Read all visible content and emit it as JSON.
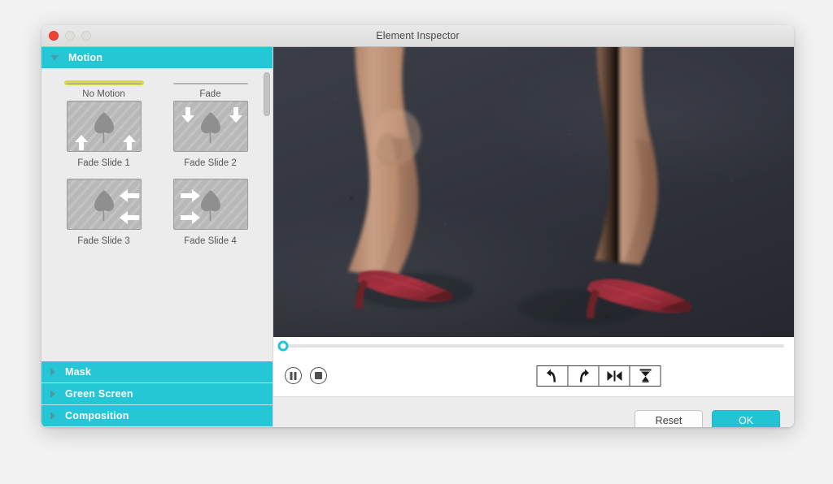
{
  "window": {
    "title": "Element Inspector",
    "traffic_lights": [
      {
        "name": "close",
        "color": "#f04134",
        "active": true
      },
      {
        "name": "minimize",
        "color": "#dededc",
        "active": false
      },
      {
        "name": "maximize",
        "color": "#dededc",
        "active": false
      }
    ]
  },
  "colors": {
    "accent_teal": "#22c4d4",
    "header_teal": "#25c6d6",
    "selection_yellow": "#d8d93a",
    "window_bg": "#ececec",
    "preview_bg": "#31343c"
  },
  "sidebar": {
    "sections": [
      {
        "id": "motion",
        "label": "Motion",
        "expanded": true,
        "triangle": "triangle-down-icon"
      },
      {
        "id": "mask",
        "label": "Mask",
        "expanded": false,
        "triangle": "triangle-right-icon"
      },
      {
        "id": "greenscreen",
        "label": "Green Screen",
        "expanded": false,
        "triangle": "triangle-right-icon"
      },
      {
        "id": "composition",
        "label": "Composition",
        "expanded": false,
        "triangle": "triangle-right-icon"
      }
    ],
    "motion_presets": [
      {
        "id": "no-motion",
        "label": "No Motion",
        "selected": true,
        "tone": "light",
        "arrows": "none"
      },
      {
        "id": "fade",
        "label": "Fade",
        "selected": false,
        "tone": "light",
        "arrows": "none"
      },
      {
        "id": "fade-slide-1",
        "label": "Fade Slide 1",
        "selected": false,
        "tone": "dark",
        "arrows": "up-bottom-corners"
      },
      {
        "id": "fade-slide-2",
        "label": "Fade Slide 2",
        "selected": false,
        "tone": "dark",
        "arrows": "down-top-corners"
      },
      {
        "id": "fade-slide-3",
        "label": "Fade Slide 3",
        "selected": false,
        "tone": "dark",
        "arrows": "left-right-edge"
      },
      {
        "id": "fade-slide-4",
        "label": "Fade Slide 4",
        "selected": false,
        "tone": "dark",
        "arrows": "right-left-edge"
      }
    ],
    "scrollbar": {
      "visible": true,
      "thumb_position_percent": 2
    }
  },
  "preview": {
    "description": "Video frame: woman's legs walking on dark asphalt wearing red pointed high heels"
  },
  "scrubber": {
    "position_percent": 0,
    "playhead_icon": "playhead-circle-icon"
  },
  "transport": {
    "pause_icon": "pause-circle-icon",
    "stop_icon": "stop-circle-icon",
    "tools": [
      {
        "id": "tool-1",
        "icon": "arrow-curve-up-left-icon"
      },
      {
        "id": "tool-2",
        "icon": "arrow-curve-up-right-icon"
      },
      {
        "id": "tool-3",
        "icon": "collapse-horizontal-icon"
      },
      {
        "id": "tool-4",
        "icon": "hourglass-icon"
      }
    ]
  },
  "footer": {
    "reset_label": "Reset",
    "ok_label": "OK"
  }
}
